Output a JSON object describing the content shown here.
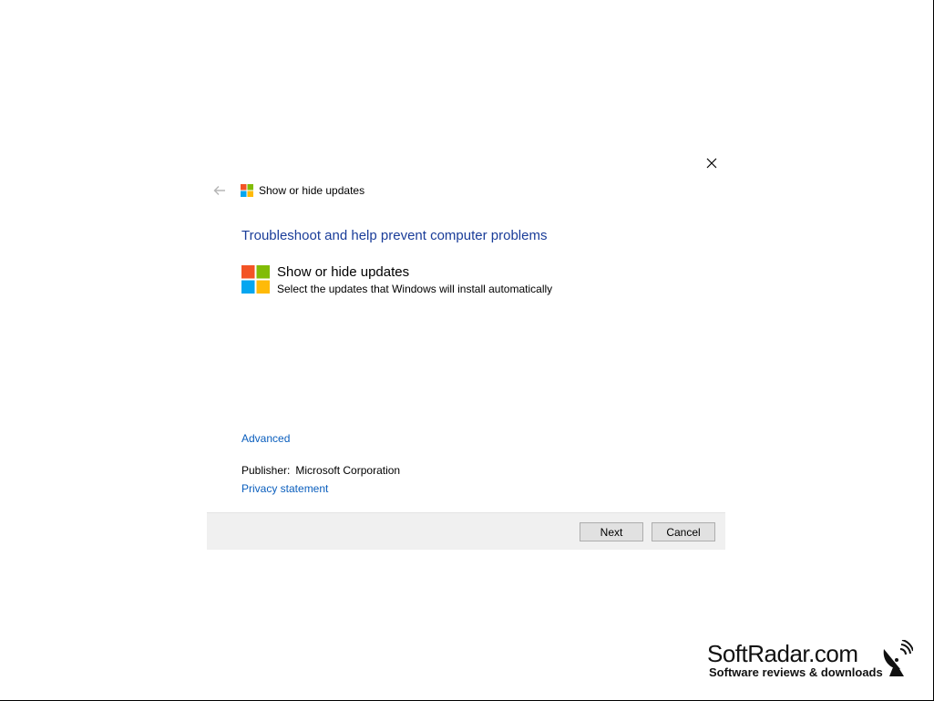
{
  "window": {
    "title": "Show or hide updates"
  },
  "main": {
    "heading": "Troubleshoot and help prevent computer problems",
    "tool": {
      "title": "Show or hide updates",
      "description": "Select the updates that Windows will install automatically"
    },
    "advanced_link": "Advanced",
    "publisher_label": "Publisher:",
    "publisher_value": "Microsoft Corporation",
    "privacy_link": "Privacy statement"
  },
  "footer": {
    "next_label": "Next",
    "cancel_label": "Cancel"
  },
  "watermark": {
    "title": "SoftRadar.com",
    "subtitle": "Software reviews & downloads"
  },
  "icons": {
    "close": "close-icon",
    "back": "back-arrow-icon",
    "logo": "windows-logo-icon",
    "satellite": "satellite-dish-icon"
  },
  "colors": {
    "heading": "#1a3d99",
    "link": "#0a5ebd",
    "footer_bg": "#f0f0f0",
    "logo_red": "#f35325",
    "logo_green": "#81bc06",
    "logo_blue": "#05a6f0",
    "logo_yellow": "#ffba08"
  }
}
